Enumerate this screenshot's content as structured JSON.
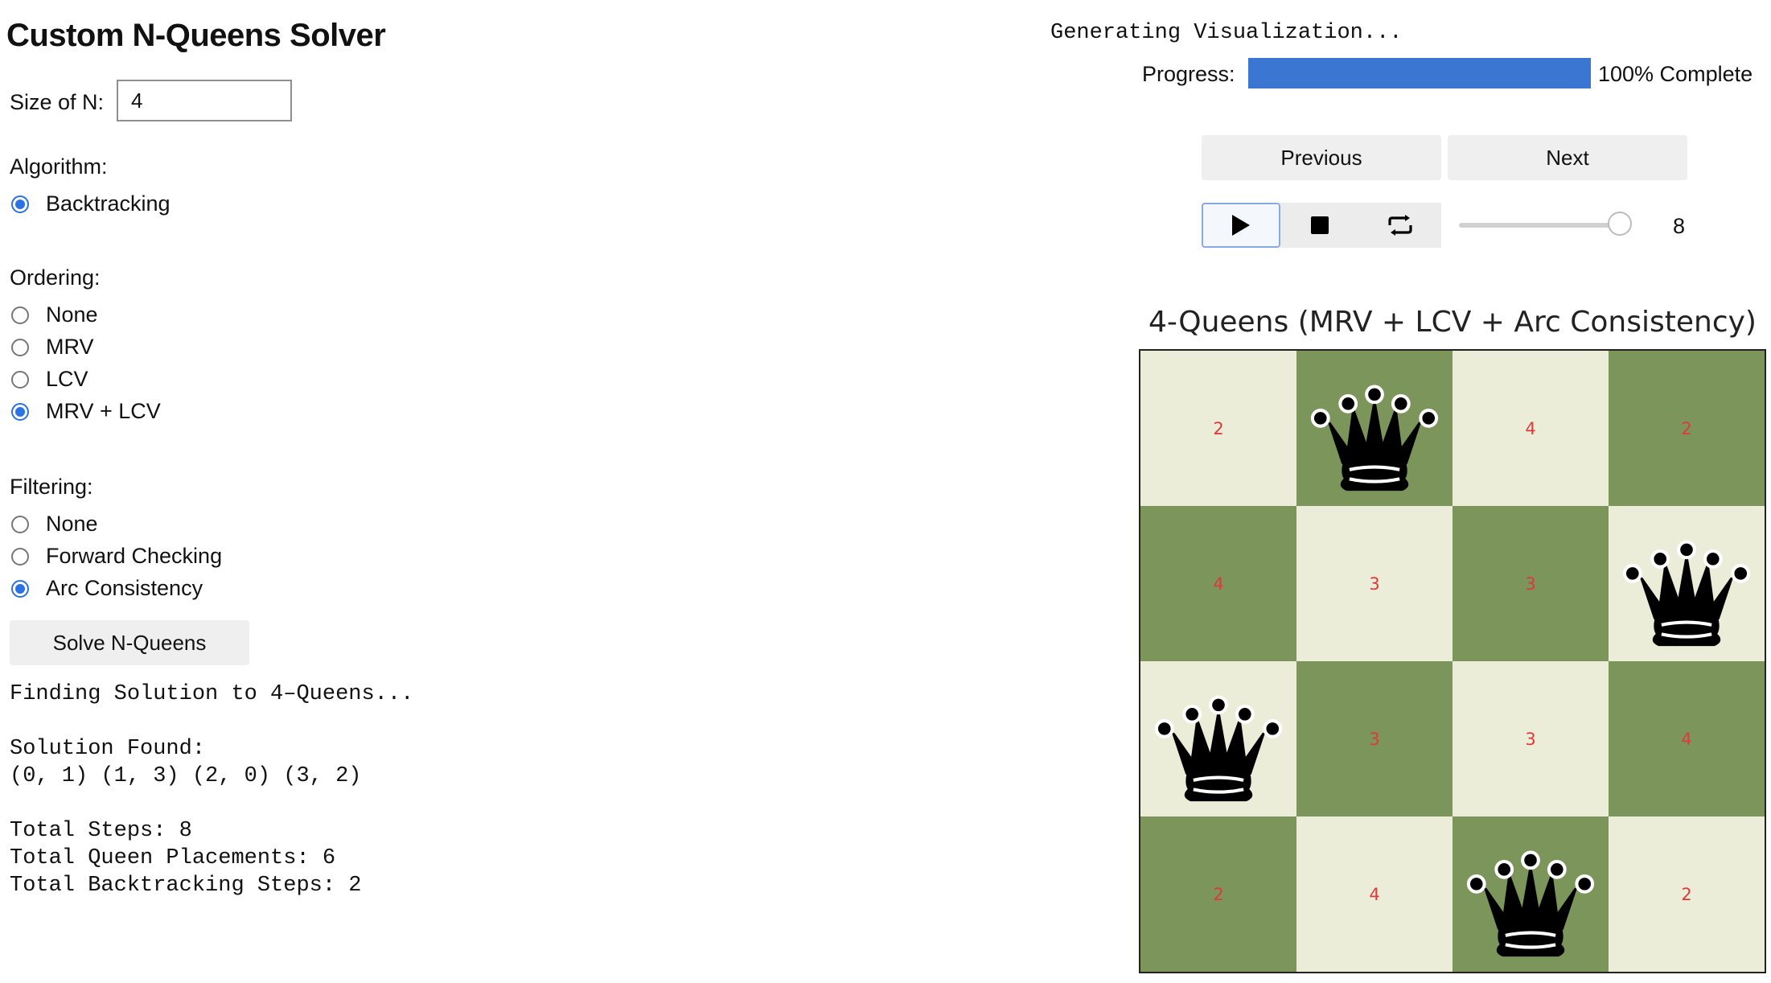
{
  "app": {
    "title": "Custom N-Queens Solver"
  },
  "size": {
    "label": "Size of N:",
    "value": "4"
  },
  "algorithm": {
    "label": "Algorithm:",
    "options": [
      {
        "label": "Backtracking",
        "checked": true
      }
    ]
  },
  "ordering": {
    "label": "Ordering:",
    "options": [
      {
        "label": "None",
        "checked": false
      },
      {
        "label": "MRV",
        "checked": false
      },
      {
        "label": "LCV",
        "checked": false
      },
      {
        "label": "MRV + LCV",
        "checked": true
      }
    ]
  },
  "filtering": {
    "label": "Filtering:",
    "options": [
      {
        "label": "None",
        "checked": false
      },
      {
        "label": "Forward Checking",
        "checked": false
      },
      {
        "label": "Arc Consistency",
        "checked": true
      }
    ]
  },
  "solve_button": {
    "label": "Solve N-Queens"
  },
  "output": {
    "finding": "Finding Solution to 4–Queens...",
    "found_label": "Solution Found:",
    "solution": "(0, 1) (1, 3) (2, 0) (3, 2)",
    "total_steps": "Total Steps: 8",
    "total_placements": "Total Queen Placements: 6",
    "total_backtracking": "Total Backtracking Steps: 2"
  },
  "visualization": {
    "generating": "Generating Visualization...",
    "progress_label": "Progress:",
    "progress_percent": 100,
    "progress_text": "100% Complete",
    "previous_label": "Previous",
    "next_label": "Next",
    "controls": {
      "play_icon": "play-icon",
      "stop_icon": "stop-icon",
      "repeat_icon": "repeat-icon"
    },
    "step_slider_value": 8,
    "step_slider_max": 8,
    "step_display": "8"
  },
  "board": {
    "title": "4-Queens (MRV + LCV + Arc Consistency)",
    "n": 4,
    "colors": {
      "light": "#ecedd8",
      "dark": "#7b955b",
      "number": "#dd3a3a",
      "queen": "#000000"
    },
    "cells": [
      [
        "2",
        "Q",
        "4",
        "2"
      ],
      [
        "4",
        "3",
        "3",
        "Q"
      ],
      [
        "Q",
        "3",
        "3",
        "4"
      ],
      [
        "2",
        "4",
        "Q",
        "2"
      ]
    ]
  }
}
